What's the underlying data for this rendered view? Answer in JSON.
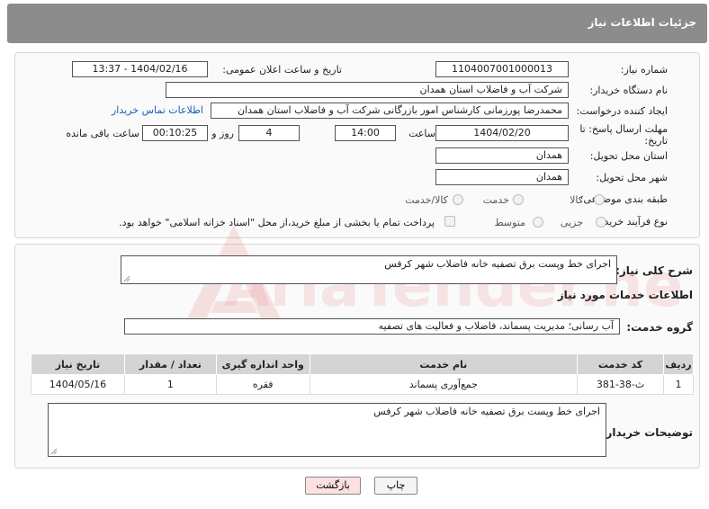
{
  "header": {
    "title": "جزئیات اطلاعات نیاز"
  },
  "form": {
    "need_number_label": "شماره نیاز:",
    "need_number": "1104007001000013",
    "announce_label": "تاریخ و ساعت اعلان عمومی:",
    "announce_value": "1404/02/16 - 13:37",
    "buyer_org_label": "نام دستگاه خریدار:",
    "buyer_org": "شرکت آب و فاضلاب استان همدان",
    "creator_label": "ایجاد کننده درخواست:",
    "creator": "محمدرضا پورزمانی کارشناس امور بازرگانی شرکت آب و فاضلاب استان همدان",
    "contact_link": "اطلاعات تماس خریدار",
    "deadline_label_1": "مهلت ارسال پاسخ: تا",
    "deadline_label_2": "تاریخ:",
    "deadline_date": "1404/02/20",
    "time_label": "ساعت",
    "deadline_time": "14:00",
    "days_value": "4",
    "days_label": "روز و",
    "remaining_time": "00:10:25",
    "remaining_label": "ساعت باقی مانده",
    "province_label": "استان محل تحویل:",
    "province": "همدان",
    "city_label": "شهر محل تحویل:",
    "city": "همدان",
    "category_label": "طبقه بندی موضوعی:",
    "category_options": [
      "کالا",
      "خدمت",
      "کالا/خدمت"
    ],
    "process_label": "نوع فرآیند خرید :",
    "process_options": [
      "جزیی",
      "متوسط"
    ],
    "payment_note": "پرداخت تمام یا بخشی از مبلغ خرید،از محل \"اسناد خزانه اسلامی\" خواهد بود."
  },
  "details": {
    "summary_label": "شرح کلی نیاز:",
    "summary": "اجرای خط وپست برق تصفیه خانه فاضلاب شهر کرفس",
    "services_title": "اطلاعات خدمات مورد نیاز",
    "service_group_label": "گروه خدمت:",
    "service_group": "آب رسانی؛ مدیریت پسماند، فاضلاب و فعالیت های تصفیه",
    "table": {
      "headers": [
        "ردیف",
        "کد خدمت",
        "نام خدمت",
        "واحد اندازه گیری",
        "تعداد / مقدار",
        "تاریخ نیاز"
      ],
      "rows": [
        [
          "1",
          "ث-38-381",
          "جمع‌آوری پسماند",
          "فقره",
          "1",
          "1404/05/16"
        ]
      ]
    },
    "buyer_notes_label": "توضیحات خریدار:",
    "buyer_notes": "اجرای خط وپست برق تصفیه خانه فاضلاب شهر کرفس"
  },
  "buttons": {
    "print": "چاپ",
    "back": "بازگشت"
  },
  "watermark": "AriaTender.net",
  "colors": {
    "header": "#8c8c8c",
    "link": "#1a5fb4",
    "back_button": "#fde0e0",
    "watermark": "#e06060"
  }
}
